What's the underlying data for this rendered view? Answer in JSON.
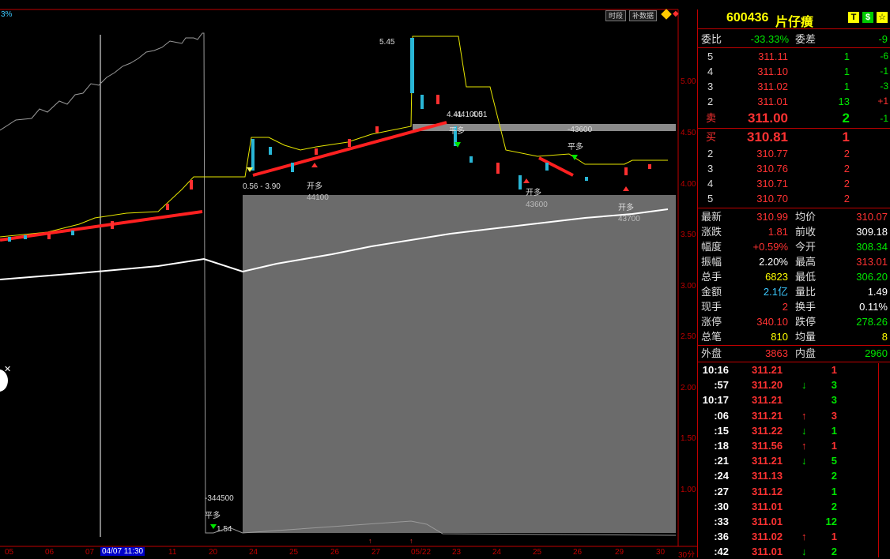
{
  "chart": {
    "corner_pct": "3%",
    "buttons": {
      "time": "时段",
      "supplement": "补数据"
    },
    "y_axis_labels": [
      "5.00",
      "4.50",
      "4.00",
      "3.50",
      "3.00",
      "2.50",
      "2.00",
      "1.50",
      "1.00"
    ],
    "date_labels": [
      "05",
      "06",
      "07",
      "04/07 11:30",
      "11",
      "20",
      "24",
      "25",
      "26",
      "27",
      "05/22",
      "23",
      "24",
      "25",
      "26",
      "29",
      "30"
    ],
    "period": "30分",
    "annotations": {
      "peak": "5.45",
      "signal_a": "0.56 - 3.90",
      "signal_a_vol": "44100",
      "signal_a_kind": "开多",
      "signal_b_price": "4.41",
      "signal_b_val": "4.51",
      "signal_b_vol": "-441000",
      "signal_b_kind": "平多",
      "signal_c_kind": "开多",
      "signal_c_vol": "43600",
      "signal_d_vol": "-43600",
      "signal_d_kind": "平多",
      "signal_e_kind": "开多",
      "signal_e_vol": "43700",
      "signal_f_vol": "-344500",
      "signal_f_kind": "平多",
      "signal_f_price": "1.54"
    }
  },
  "quote": {
    "code": "600436",
    "name": "片仔癀",
    "badges": [
      "T",
      "$",
      "☆"
    ],
    "weibi_label": "委比",
    "weibi_value": "-33.33%",
    "weicha_label": "委差",
    "weicha_value": "-9",
    "asks": [
      {
        "level": "5",
        "price": "311.11",
        "vol": "1",
        "chg": "-6"
      },
      {
        "level": "4",
        "price": "311.10",
        "vol": "1",
        "chg": "-1"
      },
      {
        "level": "3",
        "price": "311.02",
        "vol": "1",
        "chg": "-3"
      },
      {
        "level": "2",
        "price": "311.01",
        "vol": "13",
        "chg": "+1"
      },
      {
        "level": "卖",
        "price": "311.00",
        "vol": "2",
        "chg": "-1"
      }
    ],
    "bids": [
      {
        "level": "买",
        "price": "310.81",
        "vol": "1"
      },
      {
        "level": "2",
        "price": "310.77",
        "vol": "2"
      },
      {
        "level": "3",
        "price": "310.76",
        "vol": "2"
      },
      {
        "level": "4",
        "price": "310.71",
        "vol": "2"
      },
      {
        "level": "5",
        "price": "310.70",
        "vol": "2"
      }
    ],
    "stats": [
      {
        "l1": "最新",
        "v1": "310.99",
        "c1": "red",
        "l2": "均价",
        "v2": "310.07",
        "c2": "red"
      },
      {
        "l1": "涨跌",
        "v1": "1.81",
        "c1": "red",
        "l2": "前收",
        "v2": "309.18",
        "c2": "white"
      },
      {
        "l1": "幅度",
        "v1": "+0.59%",
        "c1": "red",
        "l2": "今开",
        "v2": "308.34",
        "c2": "green"
      },
      {
        "l1": "振幅",
        "v1": "2.20%",
        "c1": "white",
        "l2": "最高",
        "v2": "313.01",
        "c2": "red"
      },
      {
        "l1": "总手",
        "v1": "6823",
        "c1": "yellow",
        "l2": "最低",
        "v2": "306.20",
        "c2": "green"
      },
      {
        "l1": "金额",
        "v1": "2.1亿",
        "c1": "cyan",
        "l2": "量比",
        "v2": "1.49",
        "c2": "white"
      },
      {
        "l1": "现手",
        "v1": "2",
        "c1": "red",
        "l2": "换手",
        "v2": "0.11%",
        "c2": "white"
      },
      {
        "l1": "涨停",
        "v1": "340.10",
        "c1": "red",
        "l2": "跌停",
        "v2": "278.26",
        "c2": "green"
      },
      {
        "l1": "总笔",
        "v1": "810",
        "c1": "yellow",
        "l2": "均量",
        "v2": "8",
        "c2": "yellow"
      }
    ],
    "outer_label": "外盘",
    "outer_value": "3863",
    "inner_label": "内盘",
    "inner_value": "2960",
    "ticks": [
      {
        "time": "10:16",
        "price": "311.21",
        "arrow": "",
        "vol": "1",
        "vc": "red"
      },
      {
        "time": ":57",
        "price": "311.20",
        "arrow": "↓",
        "vol": "3",
        "vc": "green"
      },
      {
        "time": "10:17",
        "price": "311.21",
        "arrow": "",
        "vol": "3",
        "vc": "green"
      },
      {
        "time": ":06",
        "price": "311.21",
        "arrow": "↑",
        "vol": "3",
        "vc": "red"
      },
      {
        "time": ":15",
        "price": "311.22",
        "arrow": "↓",
        "vol": "1",
        "vc": "green"
      },
      {
        "time": ":18",
        "price": "311.56",
        "arrow": "↑",
        "vol": "1",
        "vc": "red"
      },
      {
        "time": ":21",
        "price": "311.21",
        "arrow": "↓",
        "vol": "5",
        "vc": "green"
      },
      {
        "time": ":24",
        "price": "311.13",
        "arrow": "",
        "vol": "2",
        "vc": "green"
      },
      {
        "time": ":27",
        "price": "311.12",
        "arrow": "",
        "vol": "1",
        "vc": "green"
      },
      {
        "time": ":30",
        "price": "311.01",
        "arrow": "",
        "vol": "2",
        "vc": "green"
      },
      {
        "time": ":33",
        "price": "311.01",
        "arrow": "",
        "vol": "12",
        "vc": "green"
      },
      {
        "time": ":36",
        "price": "311.02",
        "arrow": "↑",
        "vol": "1",
        "vc": "red"
      },
      {
        "time": ":42",
        "price": "311.01",
        "arrow": "↓",
        "vol": "2",
        "vc": "green"
      }
    ]
  }
}
